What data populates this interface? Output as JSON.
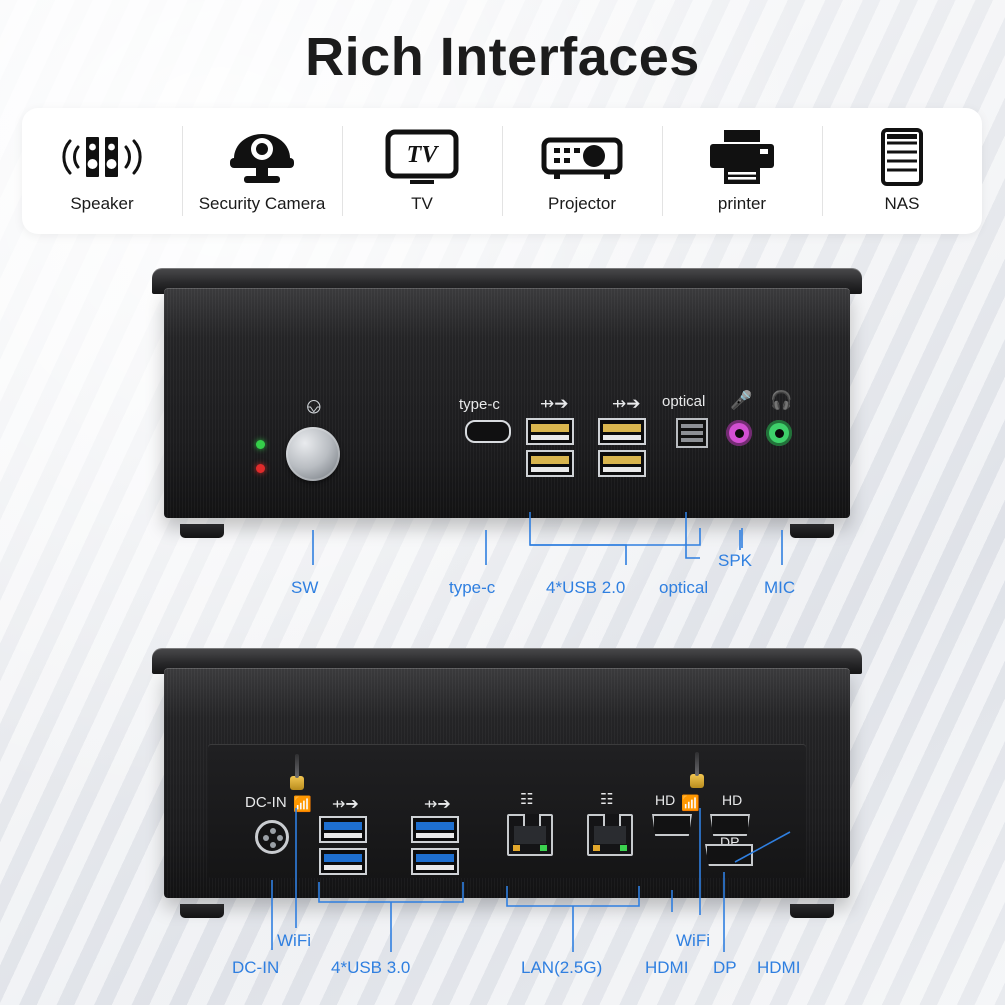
{
  "title": "Rich Interfaces",
  "icon_strip": [
    {
      "icon": "speaker-icon",
      "label": "Speaker"
    },
    {
      "icon": "security-camera-icon",
      "label": "Security Camera"
    },
    {
      "icon": "tv-icon",
      "label": "TV"
    },
    {
      "icon": "projector-icon",
      "label": "Projector"
    },
    {
      "icon": "printer-icon",
      "label": "printer"
    },
    {
      "icon": "nas-icon",
      "label": "NAS"
    }
  ],
  "front_panel": {
    "port_labels": {
      "typec": "type-c",
      "optical": "optical",
      "usb_left": "usb-superspeed-symbol",
      "usb_right": "usb-superspeed-symbol",
      "mic": "mic-icon",
      "spk": "headphone-icon"
    },
    "callouts": [
      {
        "name": "sw",
        "text": "SW"
      },
      {
        "name": "type-c",
        "text": "type-c"
      },
      {
        "name": "usb20",
        "text": "4*USB 2.0"
      },
      {
        "name": "optical",
        "text": "optical"
      },
      {
        "name": "spk",
        "text": "SPK"
      },
      {
        "name": "mic",
        "text": "MIC"
      }
    ],
    "jack_colors": {
      "mic": "#d14fd1",
      "spk": "#3ed06a"
    }
  },
  "rear_panel": {
    "port_labels": {
      "dcin": "DC-IN",
      "wifi_left": "wifi-icon",
      "wifi_right": "wifi-icon",
      "usb_left": "usb-superspeed-symbol",
      "usb_right": "usb-superspeed-symbol",
      "lan_left": "lan-icon",
      "lan_right": "lan-icon",
      "hd_left": "HD",
      "hd_right": "HD",
      "dp": "DP"
    },
    "callouts": [
      {
        "name": "wifi",
        "text": "WiFi"
      },
      {
        "name": "dc-in",
        "text": "DC-IN"
      },
      {
        "name": "usb30",
        "text": "4*USB 3.0"
      },
      {
        "name": "lan",
        "text": "LAN(2.5G)"
      },
      {
        "name": "hdmi-left",
        "text": "HDMI"
      },
      {
        "name": "wifi-right",
        "text": "WiFi"
      },
      {
        "name": "dp",
        "text": "DP"
      },
      {
        "name": "hdmi-right",
        "text": "HDMI"
      }
    ]
  },
  "colors": {
    "callout": "#2f7fe0",
    "usb2": "#d9b54e",
    "usb3": "#1e6fd0"
  }
}
